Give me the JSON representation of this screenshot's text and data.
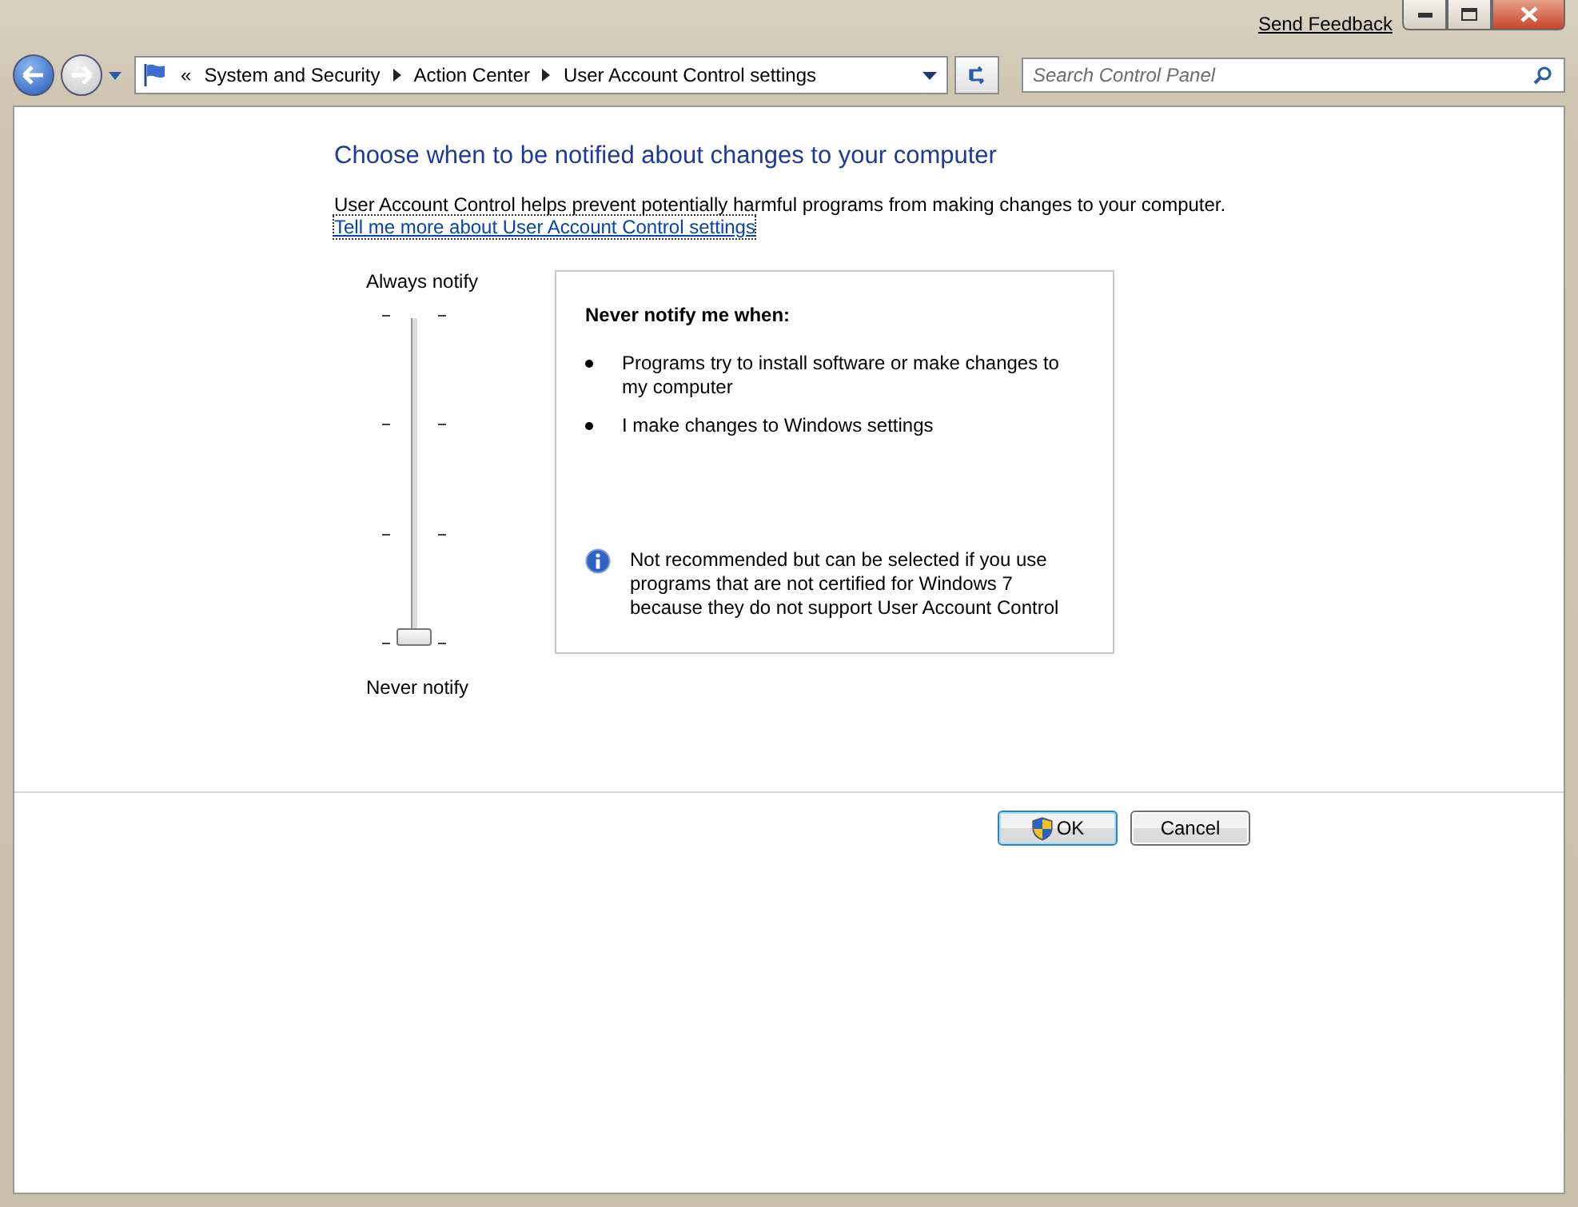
{
  "title_bar": {
    "feedback_link": "Send Feedback"
  },
  "nav": {
    "overflow": "«",
    "breadcrumb": [
      {
        "label": "System and Security"
      },
      {
        "label": "Action Center"
      },
      {
        "label": "User Account Control settings"
      }
    ],
    "search": {
      "placeholder": "Search Control Panel"
    }
  },
  "heading": "Choose when to be notified about changes to your computer",
  "description": "User Account Control helps prevent potentially harmful programs from making changes to your computer.",
  "help_link": "Tell me more about User Account Control settings",
  "slider": {
    "top_label": "Always notify",
    "bottom_label": "Never notify",
    "level": 0
  },
  "info_box": {
    "title": "Never notify me when:",
    "bullets": [
      "Programs try to install software or make changes to my computer",
      "I make changes to Windows settings"
    ],
    "note": "Not recommended but can be selected if you use programs that are not certified for Windows 7 because they do not support User Account Control"
  },
  "buttons": [
    {
      "kind": "shield",
      "label": "OK",
      "default": true
    },
    {
      "kind": "plain",
      "label": "Cancel",
      "default": false
    }
  ]
}
